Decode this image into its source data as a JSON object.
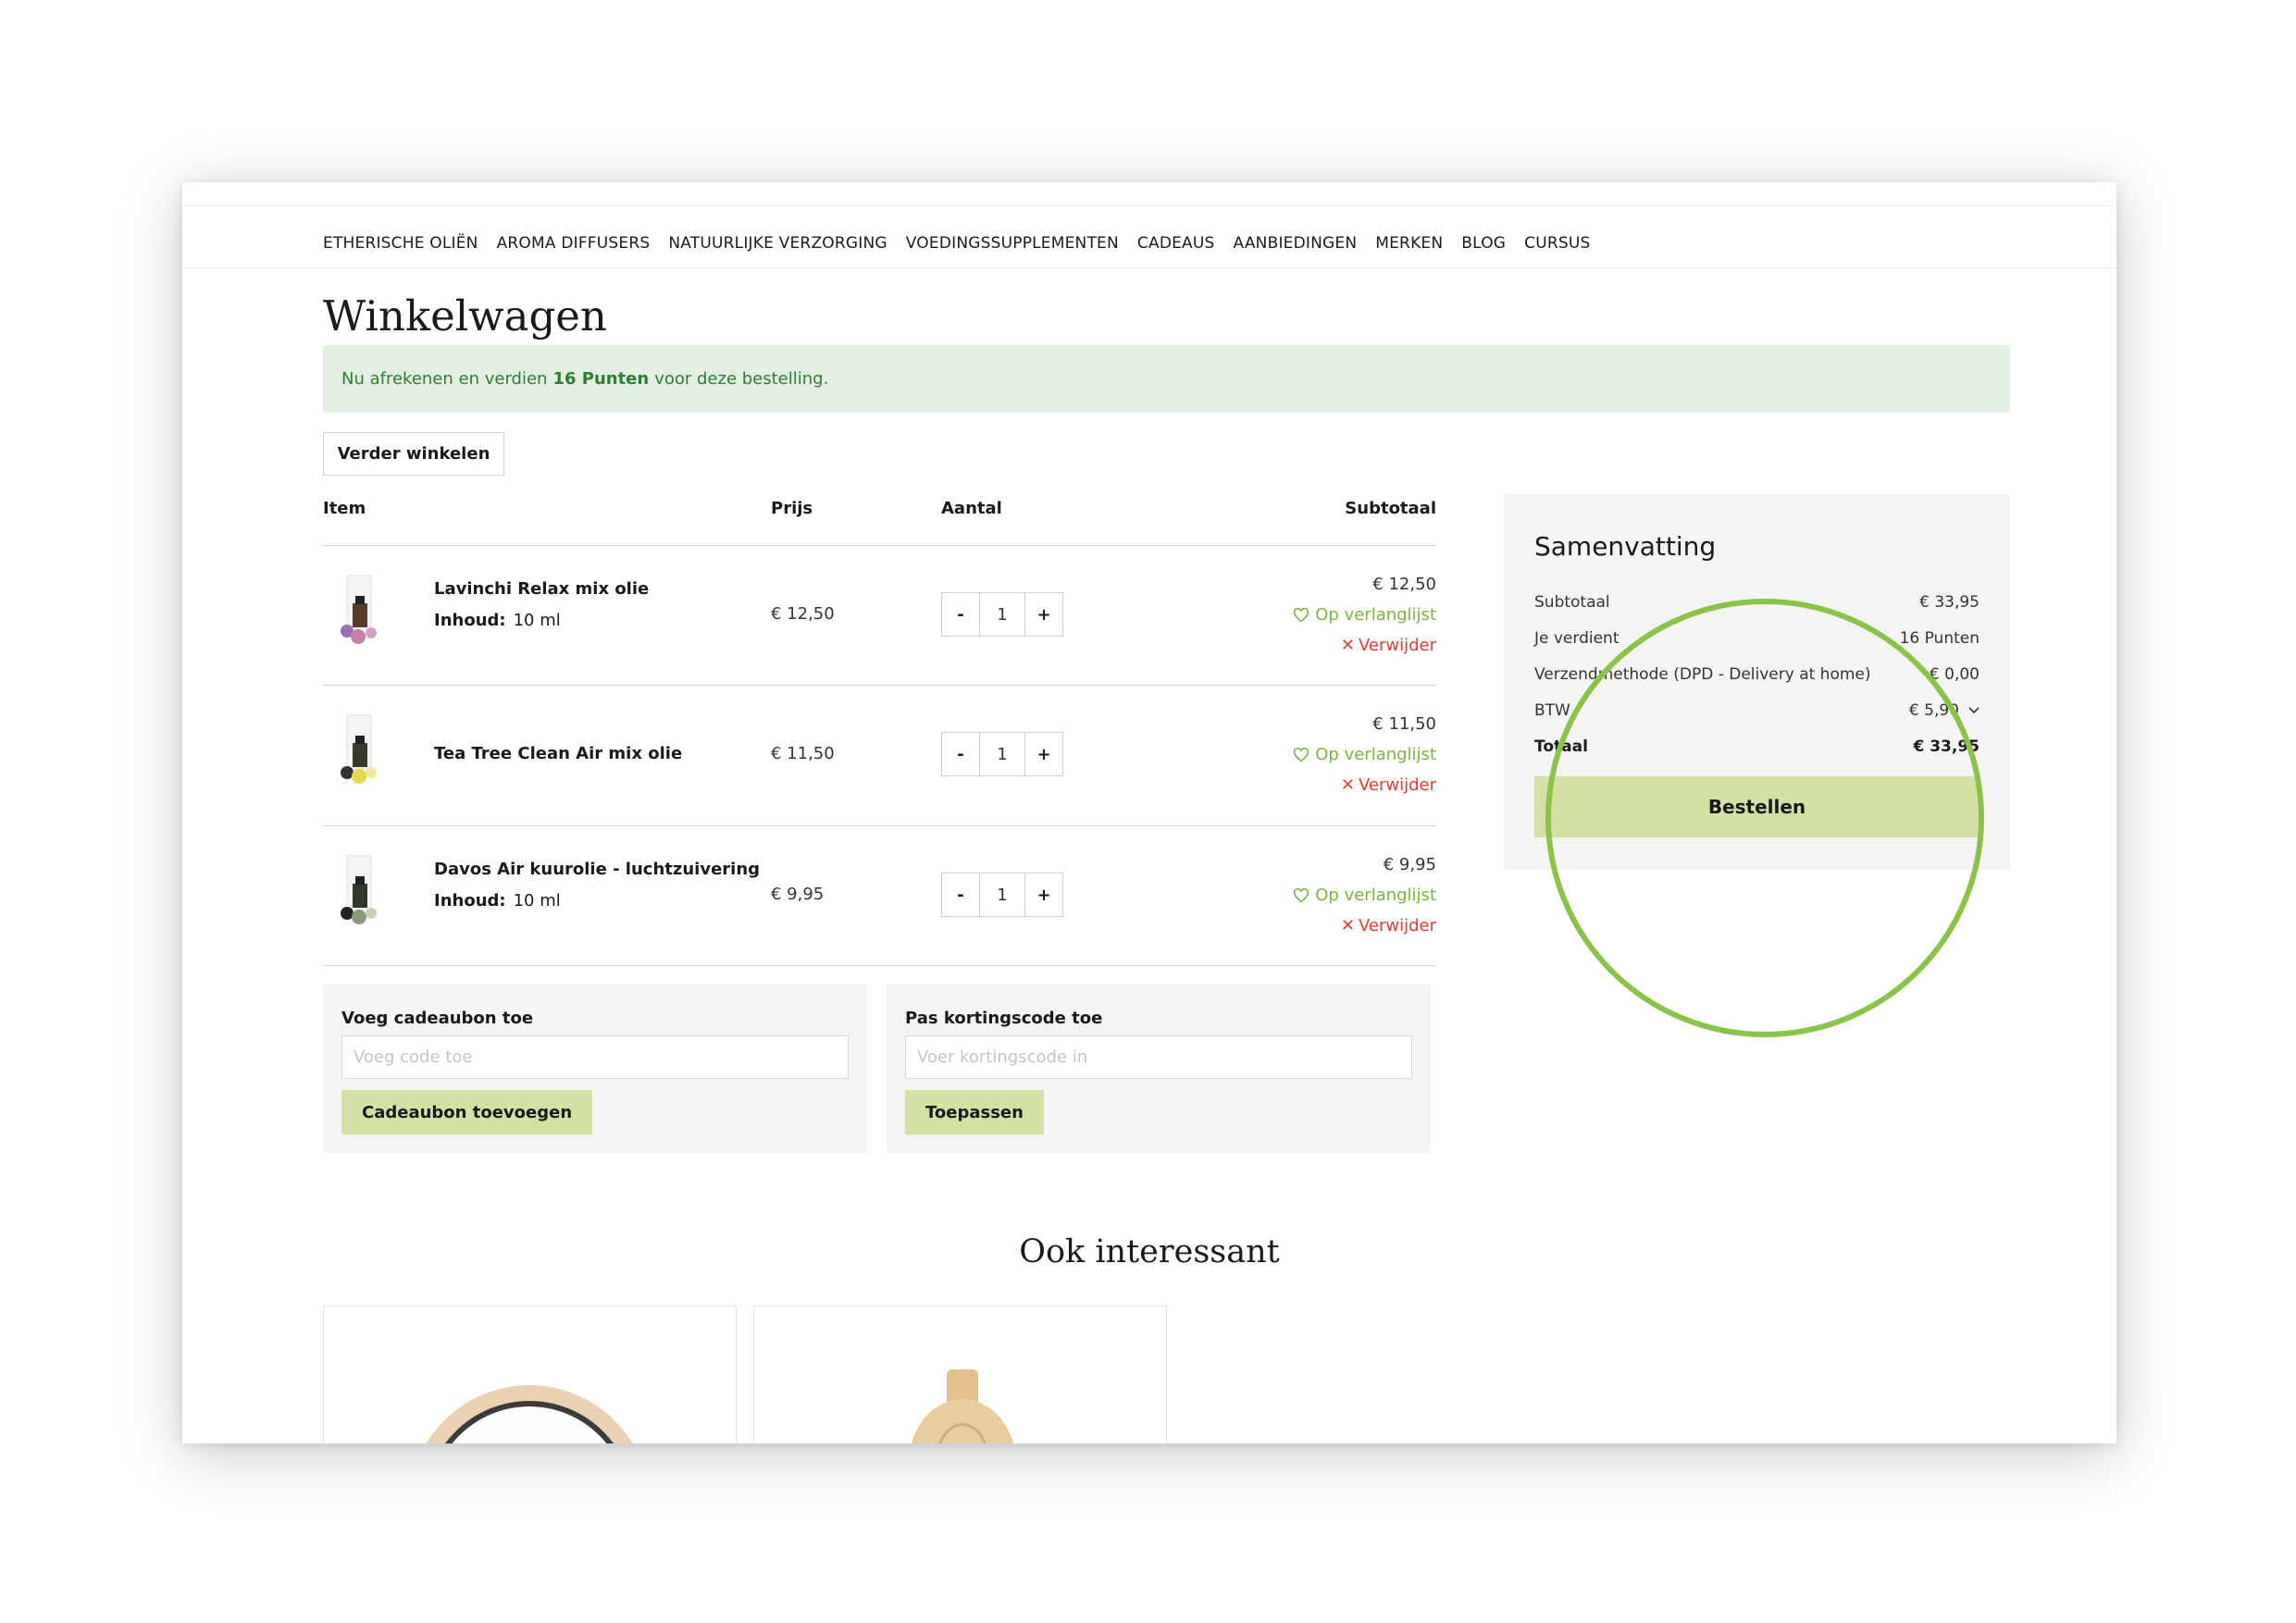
{
  "nav": {
    "items": [
      "ETHERISCHE OLIËN",
      "AROMA DIFFUSERS",
      "NATUURLIJKE VERZORGING",
      "VOEDINGSSUPPLEMENTEN",
      "CADEAUS",
      "AANBIEDINGEN",
      "MERKEN",
      "BLOG",
      "CURSUS"
    ]
  },
  "page": {
    "title": "Winkelwagen"
  },
  "notice": {
    "prefix": "Nu afrekenen en verdien ",
    "points": "16 Punten",
    "suffix": " voor deze bestelling."
  },
  "continue_button": "Verder winkelen",
  "table": {
    "headers": {
      "item": "Item",
      "price": "Prijs",
      "quantity": "Aantal",
      "subtotal": "Subtotaal"
    },
    "meta_label": "Inhoud:",
    "wishlist_label": "Op verlanglijst",
    "remove_label": "Verwijder",
    "minus": "-",
    "plus": "+",
    "rows": [
      {
        "name": "Lavinchi Relax mix olie",
        "meta": "10 ml",
        "price": "€ 12,50",
        "quantity": "1",
        "subtotal": "€ 12,50"
      },
      {
        "name": "Tea Tree Clean Air mix olie",
        "price": "€ 11,50",
        "quantity": "1",
        "subtotal": "€ 11,50"
      },
      {
        "name": "Davos Air kuurolie - luchtzuivering",
        "meta": "10 ml",
        "price": "€ 9,95",
        "quantity": "1",
        "subtotal": "€ 9,95"
      }
    ]
  },
  "giftcard": {
    "title": "Voeg cadeaubon toe",
    "placeholder": "Voeg code toe",
    "button": "Cadeaubon toevoegen"
  },
  "discount": {
    "title": "Pas kortingscode toe",
    "placeholder": "Voer kortingscode in",
    "button": "Toepassen"
  },
  "summary": {
    "title": "Samenvatting",
    "rows": [
      {
        "label": "Subtotaal",
        "value": "€ 33,95"
      },
      {
        "label": "Je verdient",
        "value": "16 Punten"
      },
      {
        "label": "Verzendmethode (DPD - Delivery at home)",
        "value": "€ 0,00"
      },
      {
        "label": "BTW",
        "value": "€ 5,90"
      }
    ],
    "total_label": "Totaal",
    "total_value": "€ 33,95",
    "order_button": "Bestellen"
  },
  "recommendations": {
    "title": "Ook interessant"
  },
  "colors": {
    "accent_green": "#d3e2a4",
    "highlight_ring": "#8bc34a",
    "notice_bg": "#e4efe4",
    "notice_text": "#2e7d32",
    "wishlist": "#7cb342",
    "remove": "#e53935"
  }
}
